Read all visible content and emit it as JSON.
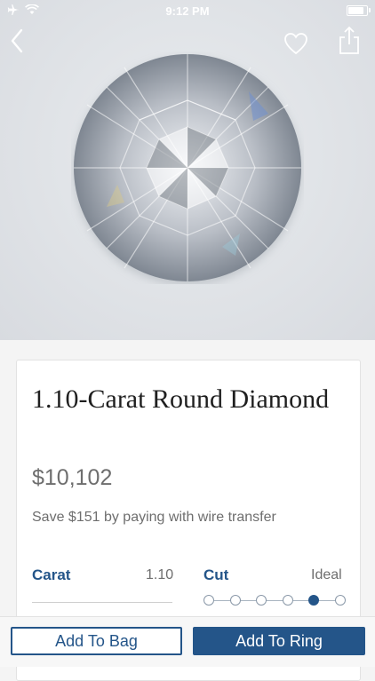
{
  "status_bar": {
    "time": "9:12 PM",
    "icons": [
      "airplane-icon",
      "wifi-icon",
      "battery-icon"
    ],
    "battery_level": 0.9
  },
  "nav": {
    "icons": [
      "back-chevron-icon",
      "heart-icon",
      "share-icon"
    ]
  },
  "product": {
    "title": "1.10-Carat Round Diamond",
    "price": "$10,102",
    "savings_note": "Save $151 by paying with wire transfer"
  },
  "specs": {
    "carat": {
      "label": "Carat",
      "value": "1.10"
    },
    "cut": {
      "label": "Cut",
      "value": "Ideal",
      "scale_steps": 6,
      "selected_step": 5
    }
  },
  "actions": {
    "add_to_bag": "Add To Bag",
    "add_to_ring": "Add To Ring"
  },
  "colors": {
    "brand_blue": "#245589",
    "text_gray": "#6e6e6e",
    "title_dark": "#1f1f1f"
  }
}
